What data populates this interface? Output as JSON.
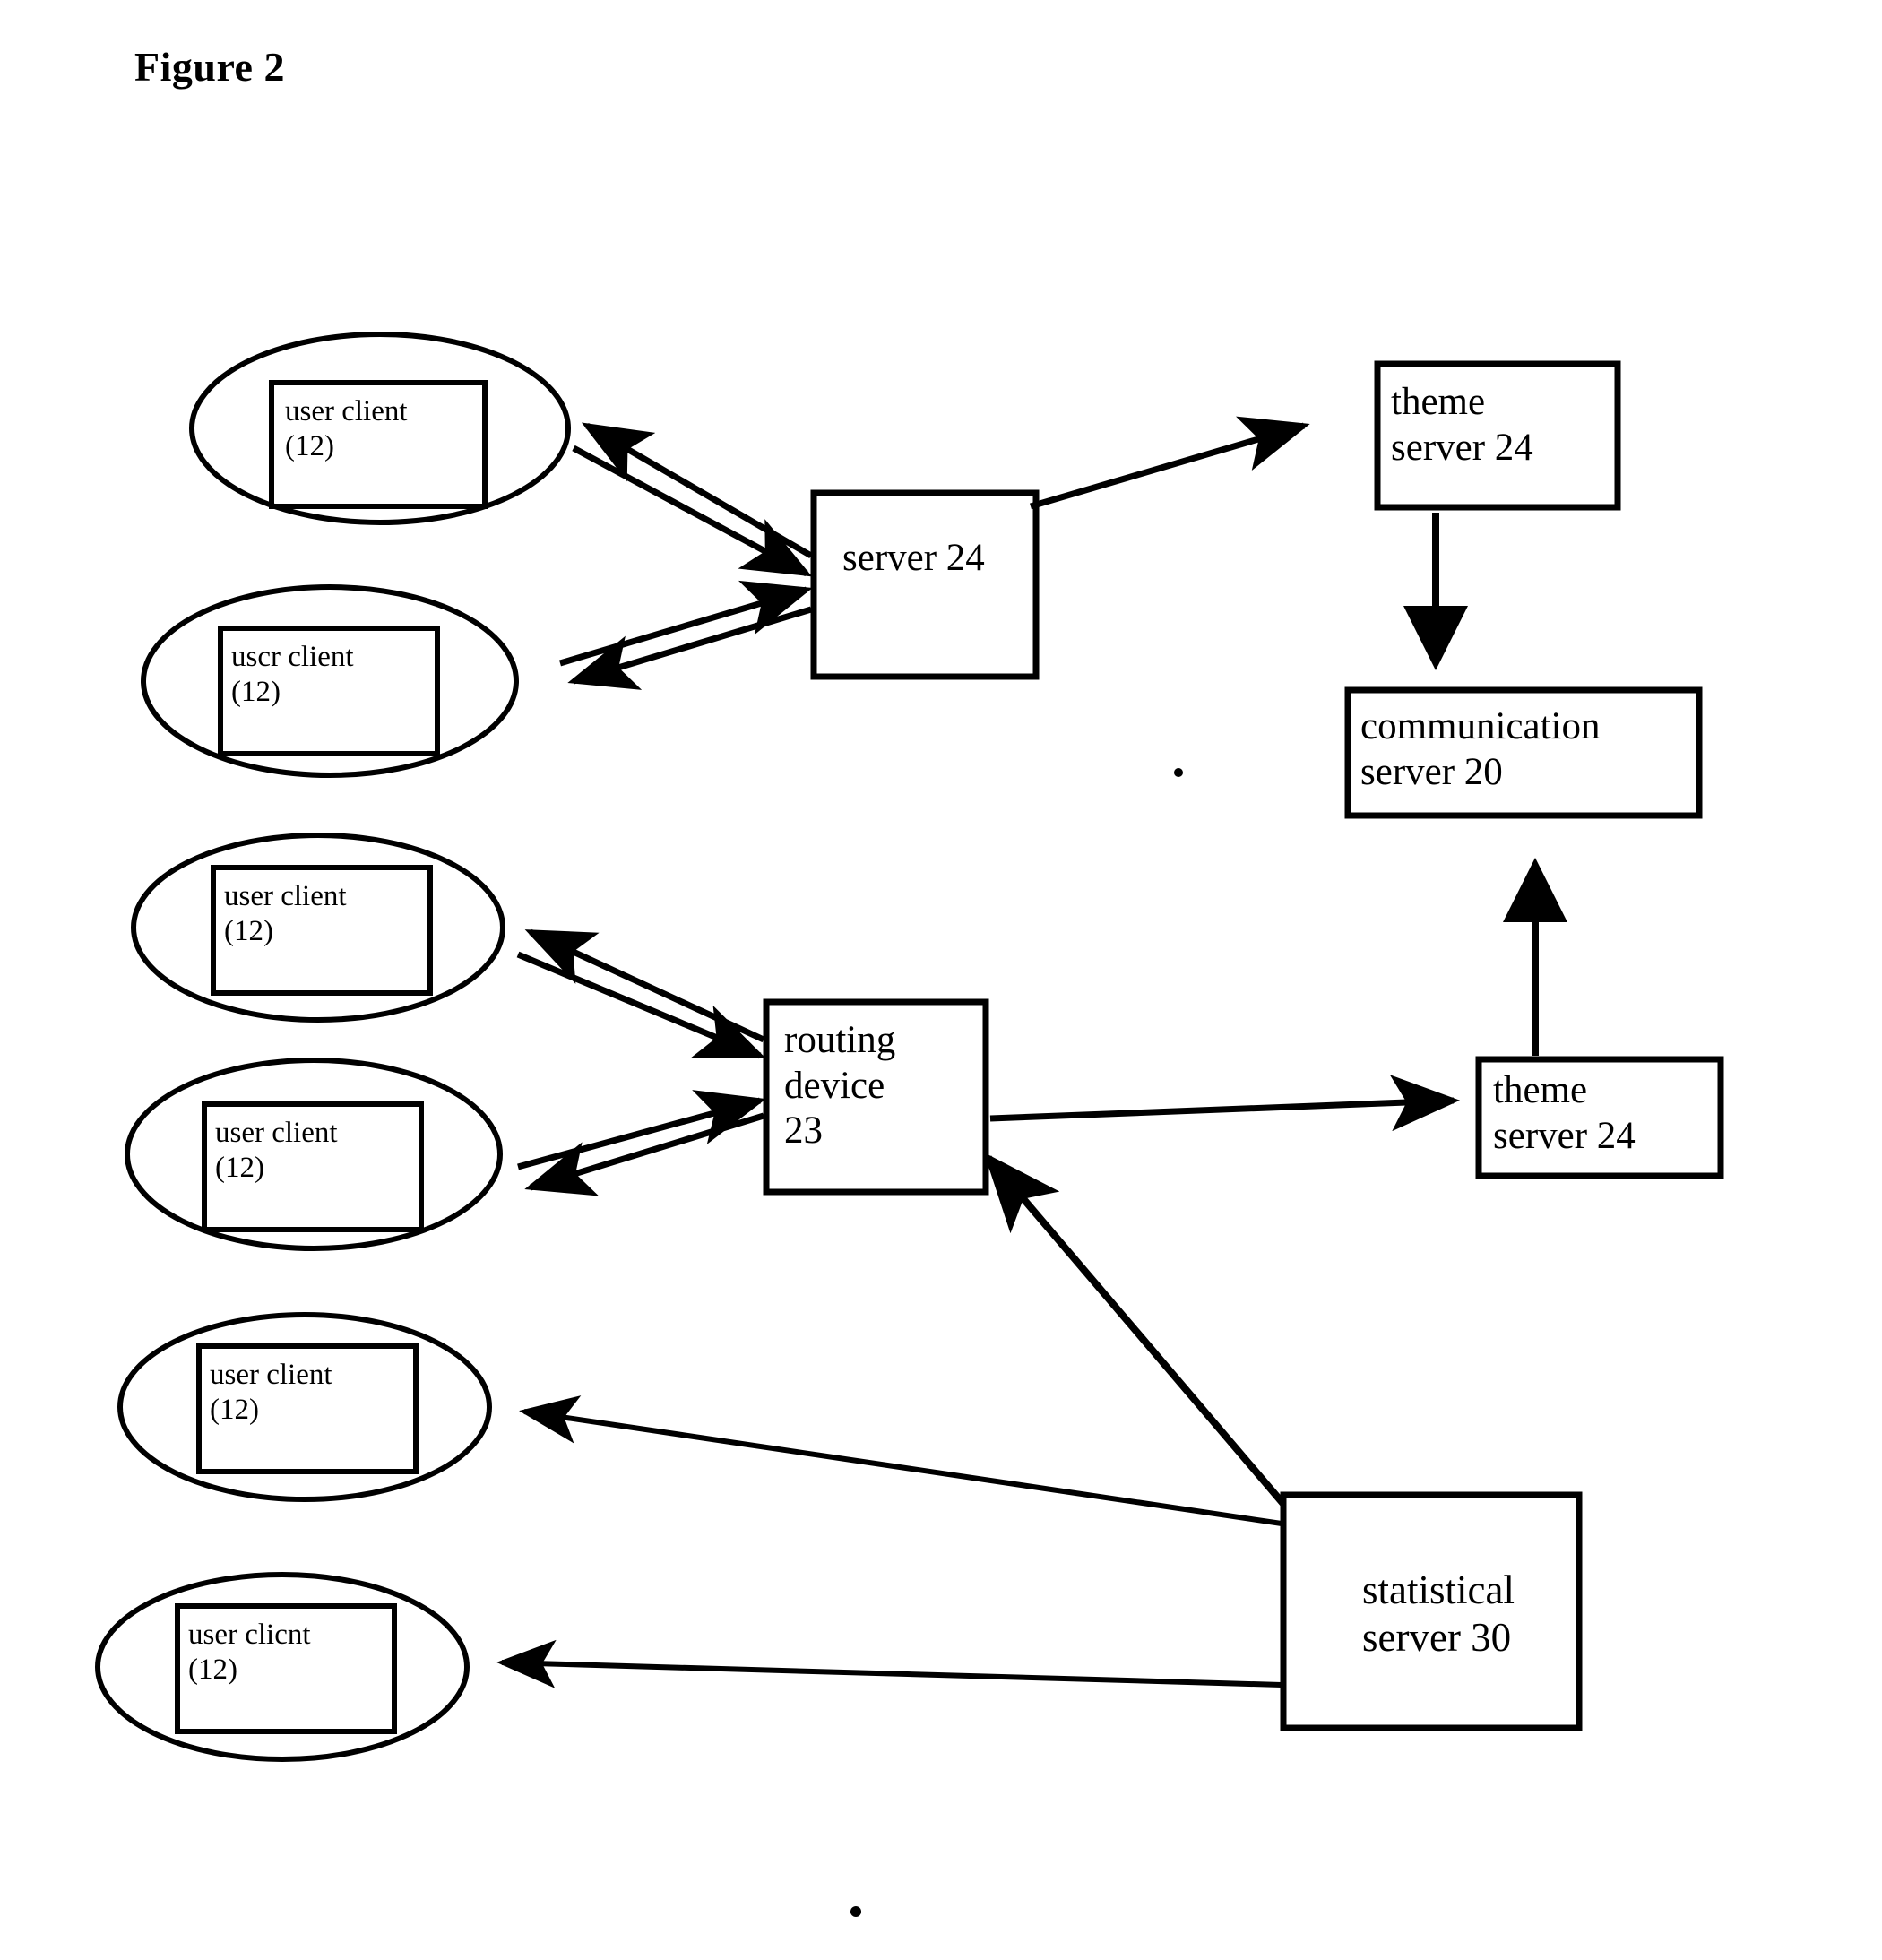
{
  "figure": {
    "title": "Figure 2",
    "ink_color": "#000000",
    "background_color": "#ffffff"
  },
  "nodes": {
    "clients": [
      {
        "id": "client-1",
        "line1": "user client",
        "line2": "(12)"
      },
      {
        "id": "client-2",
        "line1": "uscr client",
        "line2": "(12)"
      },
      {
        "id": "client-3",
        "line1": "user client",
        "line2": "(12)"
      },
      {
        "id": "client-4",
        "line1": "user client",
        "line2": "(12)"
      },
      {
        "id": "client-5",
        "line1": "user client",
        "line2": "(12)"
      },
      {
        "id": "client-6",
        "line1": "user clicnt",
        "line2": "(12)"
      }
    ],
    "boxes": [
      {
        "id": "server-24",
        "line1": "server 24",
        "line2": ""
      },
      {
        "id": "theme-server-24-top",
        "line1": "theme",
        "line2": "server 24"
      },
      {
        "id": "communication-server-20",
        "line1": "communication",
        "line2": "server 20"
      },
      {
        "id": "routing-device-23",
        "line1": "routing",
        "line2": "device",
        "line3": "23"
      },
      {
        "id": "theme-server-24-mid",
        "line1": "theme",
        "line2": "server 24"
      },
      {
        "id": "statistical-server-30",
        "line1": "statistical",
        "line2": "server 30"
      }
    ]
  },
  "chart_data": {
    "type": "diagram",
    "title": "Figure 2",
    "node_list": [
      "user client (12)",
      "uscr client (12)",
      "user client (12)",
      "user client (12)",
      "user client (12)",
      "user clicnt (12)",
      "server 24",
      "theme server 24",
      "communication server 20",
      "routing device 23",
      "theme server 24",
      "statistical server 30"
    ],
    "edges": [
      {
        "from": "server 24",
        "to": "user client (12) #1",
        "direction": "directed"
      },
      {
        "from": "user client (12) #1",
        "to": "server 24",
        "direction": "directed"
      },
      {
        "from": "server 24",
        "to": "uscr client (12) #2",
        "direction": "directed"
      },
      {
        "from": "uscr client (12) #2",
        "to": "server 24",
        "direction": "directed"
      },
      {
        "from": "server 24",
        "to": "theme server 24 (top)",
        "direction": "directed"
      },
      {
        "from": "theme server 24 (top)",
        "to": "communication server 20",
        "direction": "directed"
      },
      {
        "from": "routing device 23",
        "to": "user client (12) #3",
        "direction": "directed"
      },
      {
        "from": "user client (12) #3",
        "to": "routing device 23",
        "direction": "directed"
      },
      {
        "from": "routing device 23",
        "to": "user client (12) #4",
        "direction": "directed"
      },
      {
        "from": "user client (12) #4",
        "to": "routing device 23",
        "direction": "directed"
      },
      {
        "from": "routing device 23",
        "to": "theme server 24 (mid)",
        "direction": "directed"
      },
      {
        "from": "theme server 24 (mid)",
        "to": "communication server 20",
        "direction": "directed"
      },
      {
        "from": "statistical server 30",
        "to": "routing device 23",
        "direction": "directed"
      },
      {
        "from": "statistical server 30",
        "to": "user client (12) #5",
        "direction": "directed"
      },
      {
        "from": "statistical server 30",
        "to": "user clicnt (12) #6",
        "direction": "directed"
      }
    ]
  }
}
